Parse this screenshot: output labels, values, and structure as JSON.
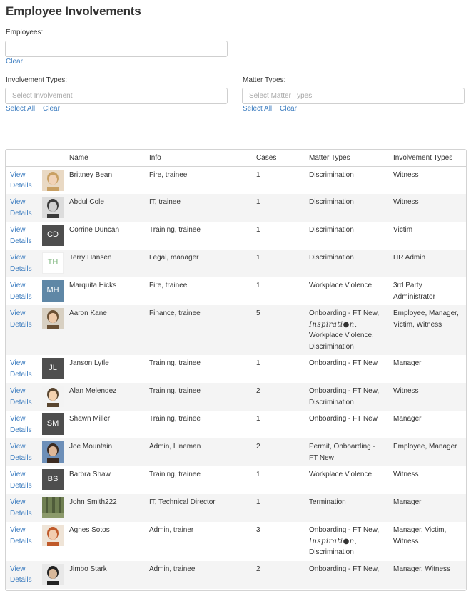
{
  "page": {
    "title": "Employee Involvements"
  },
  "filters": {
    "employees_label": "Employees:",
    "employees_clear": "Clear",
    "involvement_label": "Involvement Types:",
    "involvement_placeholder": "Select Involvement",
    "involvement_select_all": "Select All",
    "involvement_clear": "Clear",
    "matter_label": "Matter Types:",
    "matter_placeholder": "Select Matter Types",
    "matter_select_all": "Select All",
    "matter_clear": "Clear"
  },
  "table": {
    "headers": {
      "name": "Name",
      "info": "Info",
      "cases": "Cases",
      "matter": "Matter Types",
      "involvement": "Involvement Types"
    },
    "view_label": "View",
    "details_label": "Details",
    "rows": [
      {
        "name": "Brittney Bean",
        "avatar_type": "photo",
        "photo": "woman-blonde",
        "info": "Fire, trainee",
        "cases": "1",
        "matter_lines": [
          "Discrimination"
        ],
        "involvement_lines": [
          "Witness"
        ]
      },
      {
        "name": "Abdul Cole",
        "avatar_type": "photo",
        "photo": "man-glasses-bw",
        "info": "IT, trainee",
        "cases": "1",
        "matter_lines": [
          "Discrimination"
        ],
        "involvement_lines": [
          "Witness"
        ]
      },
      {
        "name": "Corrine Duncan",
        "avatar_type": "initials",
        "initials": "CD",
        "avatar_style": "dark",
        "info": "Training, trainee",
        "cases": "1",
        "matter_lines": [
          "Discrimination"
        ],
        "involvement_lines": [
          "Victim"
        ]
      },
      {
        "name": "Terry Hansen",
        "avatar_type": "initials",
        "initials": "TH",
        "avatar_style": "light",
        "info": "Legal, manager",
        "cases": "1",
        "matter_lines": [
          "Discrimination"
        ],
        "involvement_lines": [
          "HR Admin"
        ]
      },
      {
        "name": "Marquita Hicks",
        "avatar_type": "initials",
        "initials": "MH",
        "avatar_style": "blue",
        "info": "Fire, trainee",
        "cases": "1",
        "matter_lines": [
          "Workplace Violence"
        ],
        "involvement_lines": [
          "3rd Party",
          "Administrator"
        ]
      },
      {
        "name": "Aaron Kane",
        "avatar_type": "photo",
        "photo": "man-smiling",
        "info": "Finance, trainee",
        "cases": "5",
        "matter_lines": [
          "Onboarding - FT New,",
          "Inspirati●n,",
          "Workplace Violence,",
          "Discrimination"
        ],
        "involvement_lines": [
          "Employee, Manager,",
          "Victim, Witness"
        ]
      },
      {
        "name": "Janson Lytle",
        "avatar_type": "initials",
        "initials": "JL",
        "avatar_style": "dark",
        "info": "Training, trainee",
        "cases": "1",
        "matter_lines": [
          "Onboarding - FT New"
        ],
        "involvement_lines": [
          "Manager"
        ]
      },
      {
        "name": "Alan Melendez",
        "avatar_type": "photo",
        "photo": "man-cartoon",
        "info": "Training, trainee",
        "cases": "2",
        "matter_lines": [
          "Onboarding - FT New,",
          "Discrimination"
        ],
        "involvement_lines": [
          "Witness"
        ]
      },
      {
        "name": "Shawn Miller",
        "avatar_type": "initials",
        "initials": "SM",
        "avatar_style": "dark",
        "info": "Training, trainee",
        "cases": "1",
        "matter_lines": [
          "Onboarding - FT New"
        ],
        "involvement_lines": [
          "Manager"
        ]
      },
      {
        "name": "Joe Mountain",
        "avatar_type": "photo",
        "photo": "man-blue",
        "info": "Admin, Lineman",
        "cases": "2",
        "matter_lines": [
          "Permit, Onboarding -",
          "FT New"
        ],
        "involvement_lines": [
          "Employee, Manager"
        ]
      },
      {
        "name": "Barbra Shaw",
        "avatar_type": "initials",
        "initials": "BS",
        "avatar_style": "dark",
        "info": "Training, trainee",
        "cases": "1",
        "matter_lines": [
          "Workplace Violence"
        ],
        "involvement_lines": [
          "Witness"
        ]
      },
      {
        "name": "John Smith222",
        "avatar_type": "photo",
        "photo": "forest",
        "info": "IT, Technical Director",
        "cases": "1",
        "matter_lines": [
          "Termination"
        ],
        "involvement_lines": [
          "Manager"
        ]
      },
      {
        "name": "Agnes Sotos",
        "avatar_type": "photo",
        "photo": "woman-red",
        "info": "Admin, trainer",
        "cases": "3",
        "matter_lines": [
          "Onboarding - FT New,",
          "Inspirati●n,",
          "Discrimination"
        ],
        "involvement_lines": [
          "Manager, Victim,",
          "Witness"
        ]
      },
      {
        "name": "Jimbo Stark",
        "avatar_type": "photo",
        "photo": "man-dark",
        "info": "Admin, trainee",
        "cases": "2",
        "matter_lines": [
          "Onboarding - FT New,"
        ],
        "involvement_lines": [
          "Manager, Witness"
        ]
      }
    ]
  },
  "colors": {
    "link": "#3a7bbf",
    "row_stripe": "#f4f4f4",
    "border": "#d3d3d3"
  }
}
